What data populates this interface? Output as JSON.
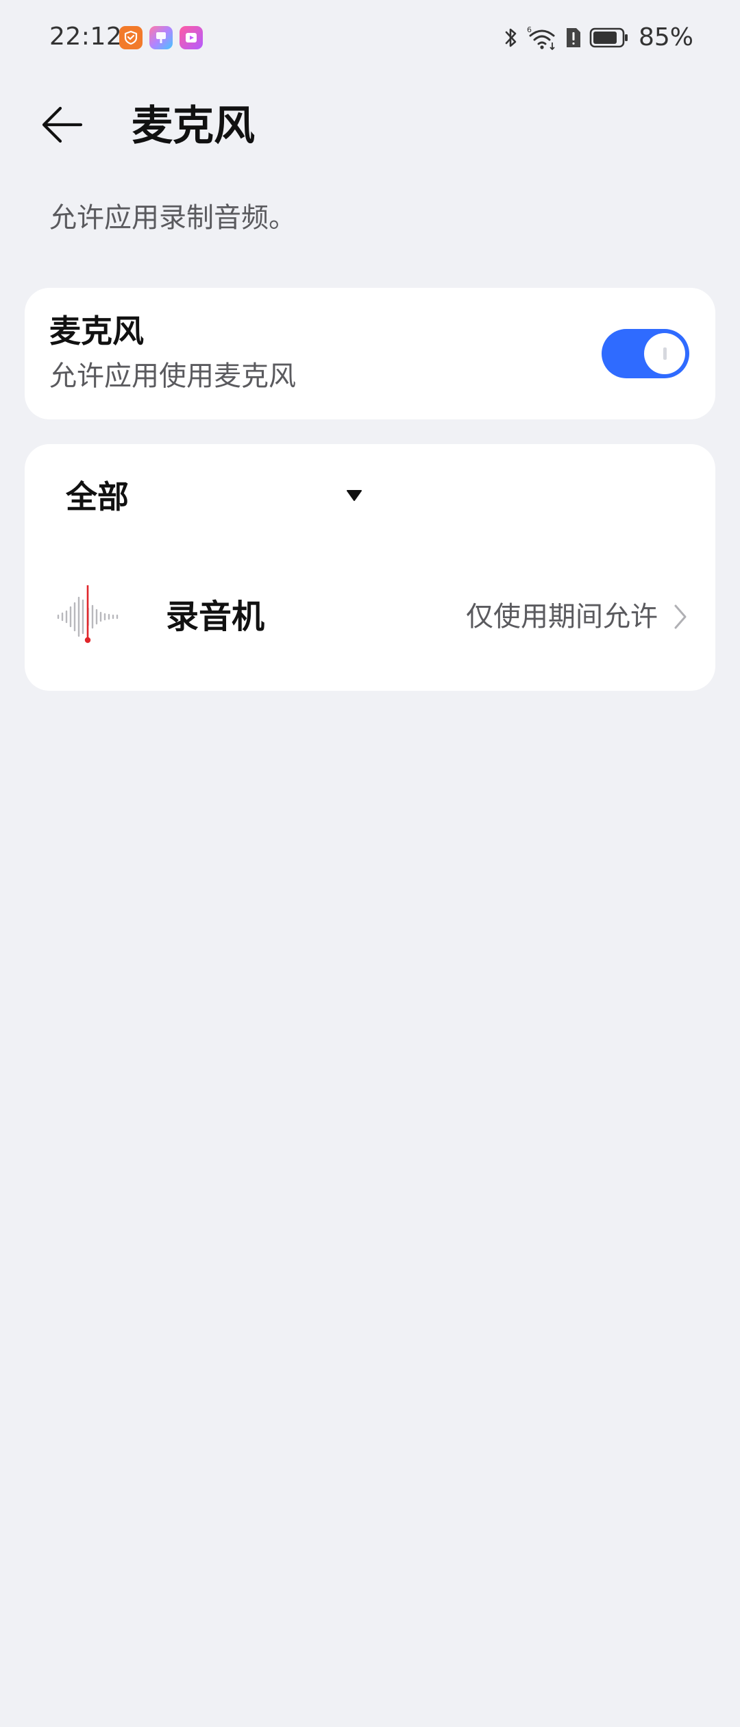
{
  "status_bar": {
    "time": "22:12",
    "battery_percent": "85%",
    "battery_level": 0.85,
    "notification_icons": [
      "app-notification-icon-orange",
      "app-notification-icon-gradient",
      "video-app-icon"
    ],
    "system_icons": [
      "bluetooth-icon",
      "wifi-6-icon",
      "alert-sim-icon",
      "battery-icon"
    ]
  },
  "header": {
    "back_icon": "back-arrow-icon",
    "title": "麦克风",
    "description": "允许应用录制音频。"
  },
  "mic_card": {
    "title": "麦克风",
    "subtitle": "允许应用使用麦克风",
    "toggle_on": true
  },
  "apps_card": {
    "filter": {
      "selected": "全部",
      "caret_icon": "caret-down-icon"
    },
    "apps": [
      {
        "name": "录音机",
        "permission": "仅使用期间允许",
        "icon": "recorder-waveform-icon"
      }
    ]
  },
  "colors": {
    "background": "#f0f1f5",
    "card": "#ffffff",
    "accent": "#2f6bff",
    "primary_text": "#111111",
    "secondary_text": "#5a5a5e",
    "recorder_red": "#e0262b"
  }
}
